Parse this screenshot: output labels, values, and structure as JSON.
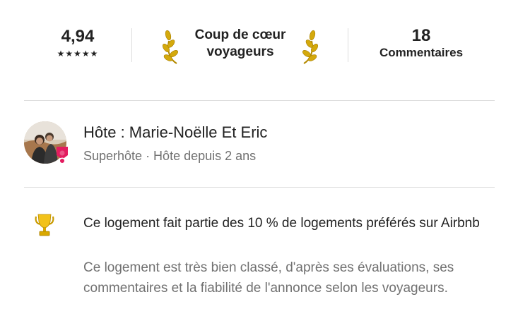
{
  "stats": {
    "rating": {
      "value": "4,94",
      "stars": "★★★★★",
      "star_count": 5
    },
    "guest_favorite": {
      "label": "Coup de cœur voyageurs",
      "icon": "laurel-icon",
      "color": "#c8a200"
    },
    "reviews": {
      "count": "18",
      "label": "Commentaires"
    }
  },
  "host": {
    "title": "Hôte : Marie-Noëlle Et Eric",
    "subtitle": "Superhôte · Hôte depuis 2 ans",
    "avatar_icon": "host-avatar",
    "badge_icon": "superhost-badge-icon",
    "badge_color": "#e31c5f"
  },
  "highlight": {
    "icon": "trophy-icon",
    "title": "Ce logement fait partie des 10 % de logements préférés sur Airbnb",
    "description": "Ce logement est très bien classé, d'après ses évaluations, ses commentaires et la fiabilité de l'annonce selon les voyageurs."
  }
}
